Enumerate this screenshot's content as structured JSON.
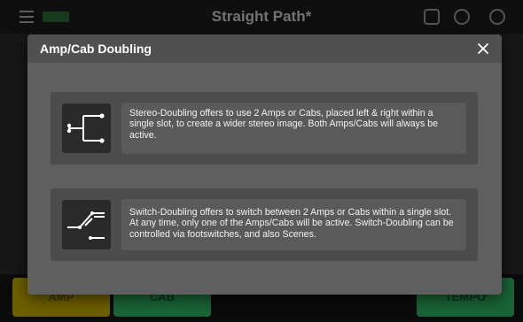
{
  "background": {
    "title": "Straight Path*",
    "buttons": {
      "amp": "AMP",
      "cab": "CAB",
      "tempo": "TEMPO"
    }
  },
  "modal": {
    "title": "Amp/Cab Doubling",
    "close_icon": "close-icon",
    "options": [
      {
        "icon": "stereo-doubling-icon",
        "description": "Stereo-Doubling offers to use 2 Amps or Cabs, placed left & right within a single slot, to create a wider stereo image. Both Amps/Cabs will always be active."
      },
      {
        "icon": "switch-doubling-icon",
        "description": "Switch-Doubling offers to switch between 2 Amps or Cabs within a single slot. At any time, only one of the Amps/Cabs will be active. Switch-Doubling can be controlled via footswitches, and also Scenes."
      }
    ]
  },
  "colors": {
    "modal_bg": "#5f5f5f",
    "card_bg": "#4c4c4c",
    "text_bg": "#5a5a5a",
    "amp_yellow": "#c9b000",
    "cab_green": "#2fb865"
  }
}
